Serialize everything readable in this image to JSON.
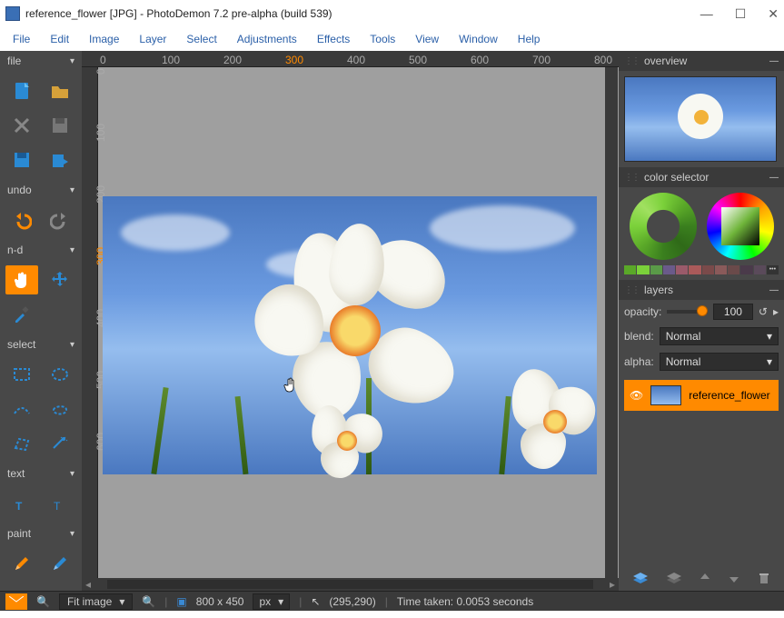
{
  "titlebar": {
    "doc": "reference_flower [JPG]",
    "app": "PhotoDemon 7.2 pre-alpha (build 539)"
  },
  "menus": [
    "File",
    "Edit",
    "Image",
    "Layer",
    "Select",
    "Adjustments",
    "Effects",
    "Tools",
    "View",
    "Window",
    "Help"
  ],
  "left": {
    "file": "file",
    "undo": "undo",
    "nd": "n-d",
    "select": "select",
    "text": "text",
    "paint": "paint"
  },
  "ruler_h": [
    "0",
    "100",
    "200",
    "300",
    "400",
    "500",
    "600",
    "700",
    "800"
  ],
  "ruler_v": [
    "0",
    "100",
    "200",
    "300",
    "400",
    "500",
    "600"
  ],
  "right": {
    "overview": "overview",
    "colorselector": "color selector",
    "layers": "layers",
    "opacity_label": "opacity:",
    "opacity_value": "100",
    "blend_label": "blend:",
    "blend_value": "Normal",
    "alpha_label": "alpha:",
    "alpha_value": "Normal",
    "layer0": "reference_flower"
  },
  "swatches": [
    "#5aa828",
    "#7bd13a",
    "#5a9a48",
    "#6a5a8a",
    "#9a5a6a",
    "#aa5a5a",
    "#7a4a4a",
    "#8a5a5a",
    "#6a4a4a",
    "#4a3a4a",
    "#5a4a5a",
    "#888"
  ],
  "status": {
    "fit": "Fit image",
    "dims": "800 x 450",
    "unit": "px",
    "coords": "(295,290)",
    "time": "Time taken: 0.0053 seconds",
    "swmore": "•••"
  }
}
